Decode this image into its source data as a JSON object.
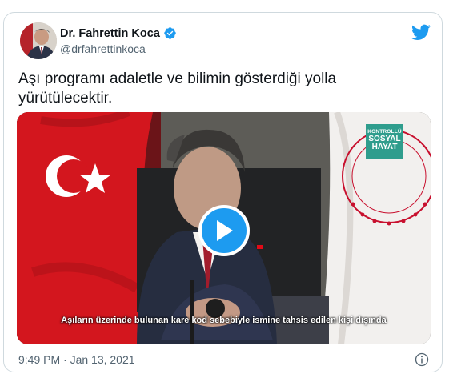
{
  "author": {
    "name": "Dr. Fahrettin Koca",
    "handle": "@drfahrettinkoca",
    "verified": true
  },
  "tweet": {
    "text": "Aşı programı adaletle ve bilimin gösterdiği yolla yürütülecektir."
  },
  "media": {
    "subtitle": "Aşıların üzerinde bulunan kare kod sebebiyle ismine tahsis edilen kişi dışında",
    "badge_line1": "KONTROLLÜ",
    "badge_line2": "SOSYAL",
    "badge_line3": "HAYAT",
    "microphone_logo": "AA"
  },
  "footer": {
    "timestamp": "9:49 PM · Jan 13, 2021"
  },
  "icons": {
    "brand": "twitter-bird-icon",
    "verified": "verified-badge-icon",
    "play": "play-icon",
    "info": "info-icon"
  },
  "colors": {
    "twitter_blue": "#1d9bf0",
    "text_primary": "#0f1419",
    "text_secondary": "#536471",
    "flag_red": "#e30a17"
  }
}
